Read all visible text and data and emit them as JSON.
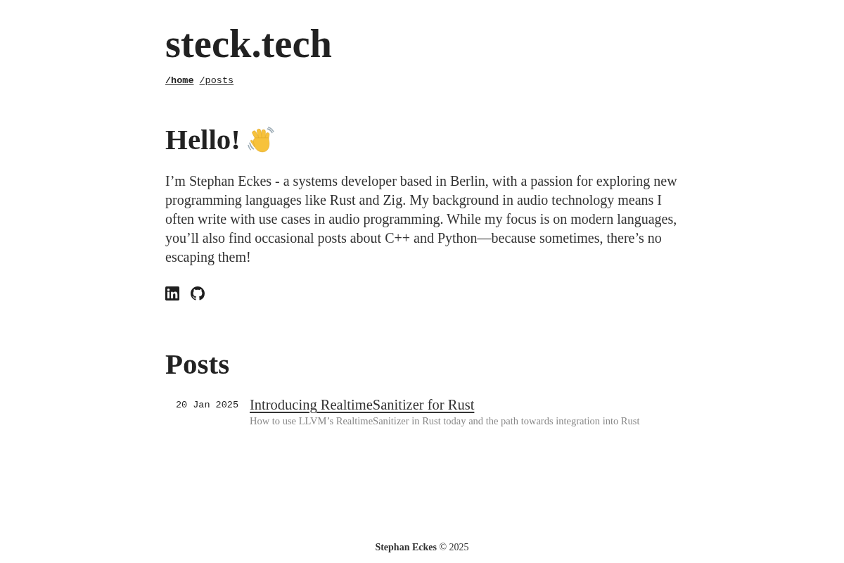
{
  "site": {
    "title": "steck.tech",
    "nav": [
      {
        "label": "/home",
        "selected": true
      },
      {
        "label": "/posts",
        "selected": false
      }
    ]
  },
  "intro": {
    "heading": "Hello!",
    "text": "I’m Stephan Eckes - a systems developer based in Berlin, with a passion for exploring new programming languages like Rust and Zig. My background in audio technology means I often write with use cases in audio programming. While my focus is on modern languages, you’ll also find occasional posts about C++ and Python—because sometimes, there’s no escaping them!",
    "social_links": [
      {
        "kind": "linkedin"
      },
      {
        "kind": "github"
      }
    ]
  },
  "posts": {
    "heading": "Posts",
    "items": [
      {
        "date": "20 Jan 2025",
        "title": "Introducing RealtimeSanitizer for Rust",
        "summary": "How to use LLVM’s RealtimeSanitizer in Rust today and the path towards integration into Rust"
      }
    ]
  },
  "footer": {
    "text": "**Stephan Eckes** © 2025"
  }
}
